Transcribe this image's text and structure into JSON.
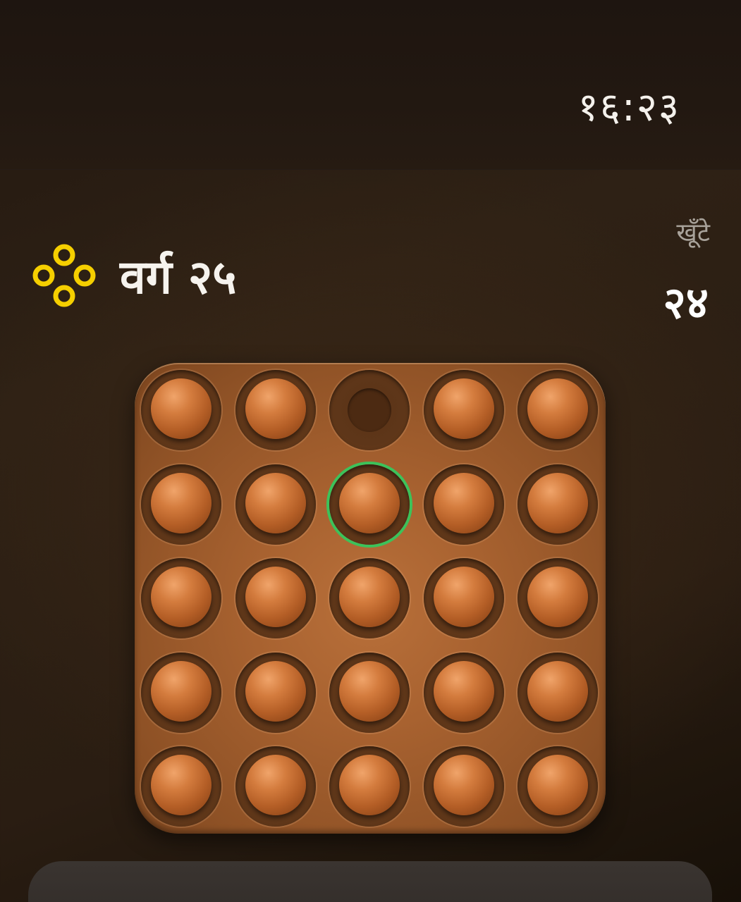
{
  "status_bar": {
    "time": "१६:२३"
  },
  "header": {
    "level_icon": "four-ring-icon",
    "level_title": "वर्ग २५",
    "pegs_label": "खूँटे",
    "pegs_count": "२४"
  },
  "colors": {
    "accent_icon": "#f5cf00",
    "selected_ring": "#3cc25a",
    "board": "#a86230",
    "peg": "#c8692c"
  },
  "board": {
    "rows": 5,
    "cols": 5,
    "cells": [
      [
        "peg",
        "peg",
        "empty",
        "peg",
        "peg"
      ],
      [
        "peg",
        "peg",
        "peg",
        "peg",
        "peg"
      ],
      [
        "peg",
        "peg",
        "peg",
        "peg",
        "peg"
      ],
      [
        "peg",
        "peg",
        "peg",
        "peg",
        "peg"
      ],
      [
        "peg",
        "peg",
        "peg",
        "peg",
        "peg"
      ]
    ],
    "selected": [
      1,
      2
    ]
  },
  "bottom_panel": {
    "label": ""
  }
}
